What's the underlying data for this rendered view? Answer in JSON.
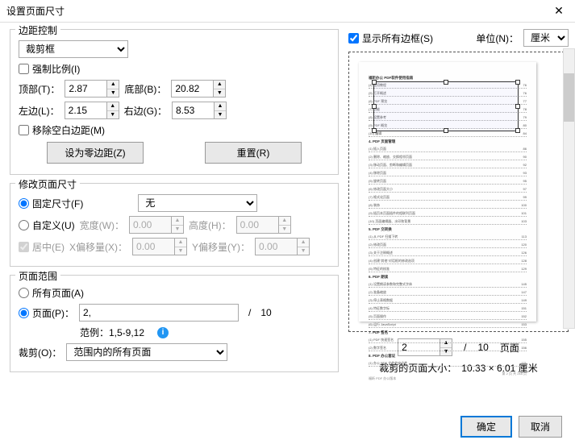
{
  "title": "设置页面尺寸",
  "margin": {
    "title": "边距控制",
    "type_select": "裁剪框",
    "force_ratio": "强制比例(I)",
    "top_label": "顶部(T)：",
    "top_value": "2.87",
    "bottom_label": "底部(B)：",
    "bottom_value": "20.82",
    "left_label": "左边(L)：",
    "left_value": "2.15",
    "right_label": "右边(G)：",
    "right_value": "8.53",
    "remove_white": "移除空白边距(M)",
    "zero_btn": "设为零边距(Z)",
    "reset_btn": "重置(R)"
  },
  "resize": {
    "title": "修改页面尺寸",
    "fixed": "固定尺寸(F)",
    "fixed_select": "无",
    "custom": "自定义(U)",
    "width_label": "宽度(W)：",
    "width_value": "0.00",
    "height_label": "高度(H)：",
    "height_value": "0.00",
    "center": "居中(E)",
    "xoffset_label": "X偏移量(X)：",
    "xoffset_value": "0.00",
    "yoffset_label": "Y偏移量(Y)：",
    "yoffset_value": "0.00"
  },
  "range": {
    "title": "页面范围",
    "all": "所有页面(A)",
    "pages": "页面(P)：",
    "pages_value": "2,",
    "total": "10",
    "example_label": "范例：1,5-9,12",
    "crop_label": "裁剪(O)：",
    "crop_select": "范围内的所有页面"
  },
  "right": {
    "show_all": "显示所有边框(S)",
    "unit_label": "单位(N)：",
    "unit_value": "厘米",
    "page_spinner": "2",
    "page_total": "10",
    "page_word": "页面",
    "size_label": "裁剪的页面大小：",
    "size_value": "10.33 × 6.01 厘米"
  },
  "buttons": {
    "ok": "确定",
    "cancel": "取消"
  },
  "slash": "/"
}
